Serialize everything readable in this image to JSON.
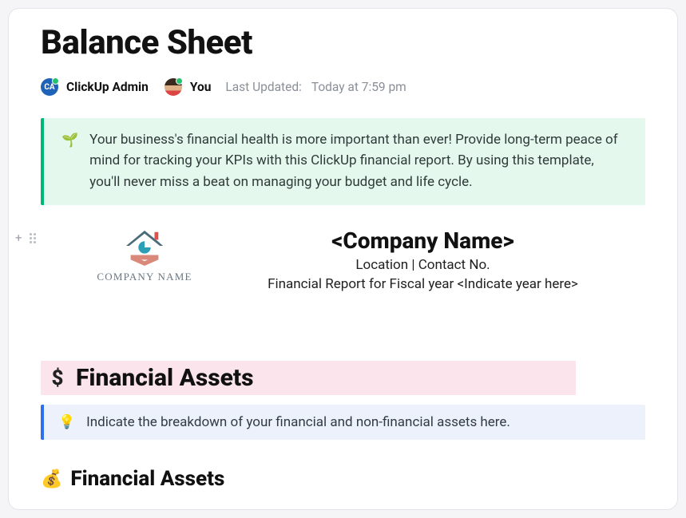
{
  "doc": {
    "title": "Balance Sheet"
  },
  "meta": {
    "admin_avatar_initials": "CA",
    "admin_label": "ClickUp Admin",
    "you_label": "You",
    "last_updated_label": "Last Updated:",
    "last_updated_value": "Today at 7:59 pm"
  },
  "callout_intro": {
    "emoji": "🌱",
    "text": "Your business's financial health is more important than ever! Provide long-term peace of mind for tracking your KPIs with this ClickUp financial report. By using this template, you'll never miss a beat on managing your budget and life cycle."
  },
  "logo": {
    "caption": "COMPANY NAME"
  },
  "company": {
    "name": "<Company Name>",
    "sub1": "Location | Contact No.",
    "sub2": "Financial Report for Fiscal year <Indicate year here>"
  },
  "section": {
    "icon": "$",
    "title": "Financial Assets"
  },
  "callout_assets": {
    "emoji": "💡",
    "text": "Indicate the breakdown of your financial and non-financial assets here."
  },
  "subsection": {
    "emoji": "💰",
    "title": "Financial Assets"
  }
}
